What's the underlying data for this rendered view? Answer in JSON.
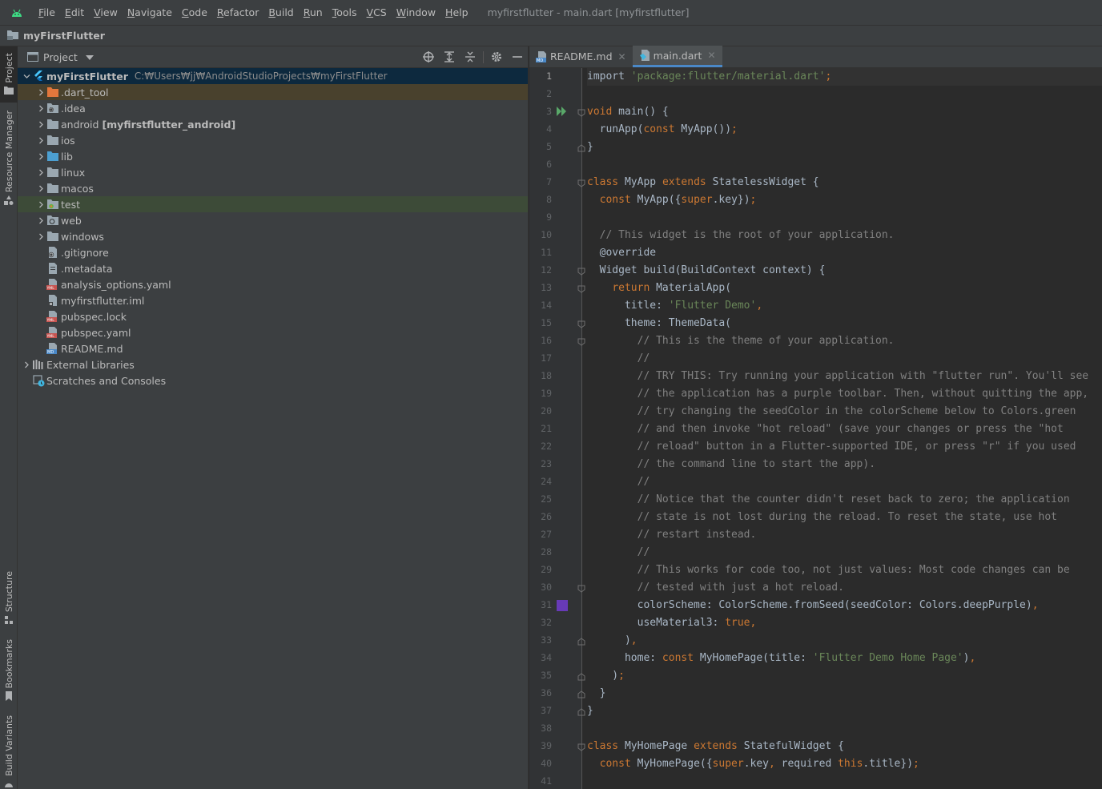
{
  "menu": {
    "items": [
      "File",
      "Edit",
      "View",
      "Navigate",
      "Code",
      "Refactor",
      "Build",
      "Run",
      "Tools",
      "VCS",
      "Window",
      "Help"
    ],
    "window_title": "myfirstflutter - main.dart [myfirstflutter]"
  },
  "navbar": {
    "project": "myFirstFlutter"
  },
  "left_stripe": {
    "project": "Project",
    "resource_manager": "Resource Manager",
    "structure": "Structure",
    "bookmarks": "Bookmarks",
    "build_variants": "Build Variants"
  },
  "project_panel": {
    "title": "Project",
    "root": {
      "name": "myFirstFlutter",
      "path": "C:₩Users₩jj₩AndroidStudioProjects₩myFirstFlutter"
    },
    "items": [
      {
        "name": ".dart_tool",
        "kind": "folder-excluded",
        "expandable": true
      },
      {
        "name": ".idea",
        "kind": "folder-idea",
        "expandable": true
      },
      {
        "name": "android",
        "suffix": "[myfirstflutter_android]",
        "kind": "folder",
        "expandable": true
      },
      {
        "name": "ios",
        "kind": "folder",
        "expandable": true
      },
      {
        "name": "lib",
        "kind": "folder-source",
        "expandable": true
      },
      {
        "name": "linux",
        "kind": "folder",
        "expandable": true
      },
      {
        "name": "macos",
        "kind": "folder",
        "expandable": true
      },
      {
        "name": "test",
        "kind": "folder-test",
        "expandable": true
      },
      {
        "name": "web",
        "kind": "folder-web",
        "expandable": true
      },
      {
        "name": "windows",
        "kind": "folder",
        "expandable": true
      },
      {
        "name": ".gitignore",
        "kind": "file-git",
        "expandable": false
      },
      {
        "name": ".metadata",
        "kind": "file",
        "expandable": false
      },
      {
        "name": "analysis_options.yaml",
        "kind": "file-yaml",
        "expandable": false
      },
      {
        "name": "myfirstflutter.iml",
        "kind": "file-iml",
        "expandable": false
      },
      {
        "name": "pubspec.lock",
        "kind": "file-yaml",
        "expandable": false
      },
      {
        "name": "pubspec.yaml",
        "kind": "file-yaml",
        "expandable": false
      },
      {
        "name": "README.md",
        "kind": "file-md",
        "expandable": false
      }
    ],
    "external_libraries": "External Libraries",
    "scratches": "Scratches and Consoles"
  },
  "editor": {
    "tabs": [
      {
        "label": "README.md",
        "active": false
      },
      {
        "label": "main.dart",
        "active": true
      }
    ],
    "current_line": 1,
    "code": [
      [
        [
          "kw0",
          "import "
        ],
        [
          "str",
          "'package:flutter/material.dart'"
        ],
        [
          "pun",
          ";"
        ]
      ],
      [],
      [
        [
          "kw",
          "void "
        ],
        [
          "plain",
          "main() {"
        ]
      ],
      [
        [
          "plain",
          "  runApp("
        ],
        [
          "kw",
          "const "
        ],
        [
          "plain",
          "MyApp())"
        ],
        [
          "pun",
          ";"
        ]
      ],
      [
        [
          "plain",
          "}"
        ]
      ],
      [],
      [
        [
          "kw",
          "class "
        ],
        [
          "plain",
          "MyApp "
        ],
        [
          "kw",
          "extends "
        ],
        [
          "plain",
          "StatelessWidget {"
        ]
      ],
      [
        [
          "plain",
          "  "
        ],
        [
          "kw",
          "const "
        ],
        [
          "plain",
          "MyApp({"
        ],
        [
          "kw",
          "super"
        ],
        [
          "plain",
          ".key})"
        ],
        [
          "pun",
          ";"
        ]
      ],
      [],
      [
        [
          "cmt",
          "  // This widget is the root of your application."
        ]
      ],
      [
        [
          "ann0",
          "  @override"
        ]
      ],
      [
        [
          "plain",
          "  Widget build(BuildContext context) {"
        ]
      ],
      [
        [
          "plain",
          "    "
        ],
        [
          "kw",
          "return "
        ],
        [
          "plain",
          "MaterialApp("
        ]
      ],
      [
        [
          "plain",
          "      title: "
        ],
        [
          "str",
          "'Flutter Demo'"
        ],
        [
          "pun",
          ","
        ]
      ],
      [
        [
          "plain",
          "      theme: ThemeData("
        ]
      ],
      [
        [
          "cmt",
          "        // This is the theme of your application."
        ]
      ],
      [
        [
          "cmt",
          "        //"
        ]
      ],
      [
        [
          "cmt",
          "        // TRY THIS: Try running your application with \"flutter run\". You'll see"
        ]
      ],
      [
        [
          "cmt",
          "        // the application has a purple toolbar. Then, without quitting the app,"
        ]
      ],
      [
        [
          "cmt",
          "        // try changing the seedColor in the colorScheme below to Colors.green"
        ]
      ],
      [
        [
          "cmt",
          "        // and then invoke \"hot reload\" (save your changes or press the \"hot"
        ]
      ],
      [
        [
          "cmt",
          "        // reload\" button in a Flutter-supported IDE, or press \"r\" if you used"
        ]
      ],
      [
        [
          "cmt",
          "        // the command line to start the app)."
        ]
      ],
      [
        [
          "cmt",
          "        //"
        ]
      ],
      [
        [
          "cmt",
          "        // Notice that the counter didn't reset back to zero; the application"
        ]
      ],
      [
        [
          "cmt",
          "        // state is not lost during the reload. To reset the state, use hot"
        ]
      ],
      [
        [
          "cmt",
          "        // restart instead."
        ]
      ],
      [
        [
          "cmt",
          "        //"
        ]
      ],
      [
        [
          "cmt",
          "        // This works for code too, not just values: Most code changes can be"
        ]
      ],
      [
        [
          "cmt",
          "        // tested with just a hot reload."
        ]
      ],
      [
        [
          "plain",
          "        colorScheme: ColorScheme.fromSeed(seedColor: Colors.deepPurple)"
        ],
        [
          "pun",
          ","
        ]
      ],
      [
        [
          "plain",
          "        useMaterial3: "
        ],
        [
          "kw",
          "true"
        ],
        [
          "pun",
          ","
        ]
      ],
      [
        [
          "plain",
          "      )"
        ],
        [
          "pun",
          ","
        ]
      ],
      [
        [
          "plain",
          "      home: "
        ],
        [
          "kw",
          "const "
        ],
        [
          "plain",
          "MyHomePage(title: "
        ],
        [
          "str",
          "'Flutter Demo Home Page'"
        ],
        [
          "plain",
          ")"
        ],
        [
          "pun",
          ","
        ]
      ],
      [
        [
          "plain",
          "    )"
        ],
        [
          "pun",
          ";"
        ]
      ],
      [
        [
          "plain",
          "  }"
        ]
      ],
      [
        [
          "plain",
          "}"
        ]
      ],
      [],
      [
        [
          "kw",
          "class "
        ],
        [
          "plain",
          "MyHomePage "
        ],
        [
          "kw",
          "extends "
        ],
        [
          "plain",
          "StatefulWidget {"
        ]
      ],
      [
        [
          "plain",
          "  "
        ],
        [
          "kw",
          "const "
        ],
        [
          "plain",
          "MyHomePage({"
        ],
        [
          "kw",
          "super"
        ],
        [
          "plain",
          ".key"
        ],
        [
          "pun",
          ", "
        ],
        [
          "plain",
          "required "
        ],
        [
          "kw",
          "this"
        ],
        [
          "plain",
          ".title})"
        ],
        [
          "pun",
          ";"
        ]
      ],
      []
    ],
    "gutter_markers": {
      "run_line": 3,
      "color_line": 31,
      "color_swatch": "#673ab7"
    }
  },
  "colors": {
    "accent": "#4a88c7",
    "keyword": "#cc7832",
    "string": "#6a8759",
    "comment": "#808080",
    "flutter_blue": "#47c5fb"
  }
}
